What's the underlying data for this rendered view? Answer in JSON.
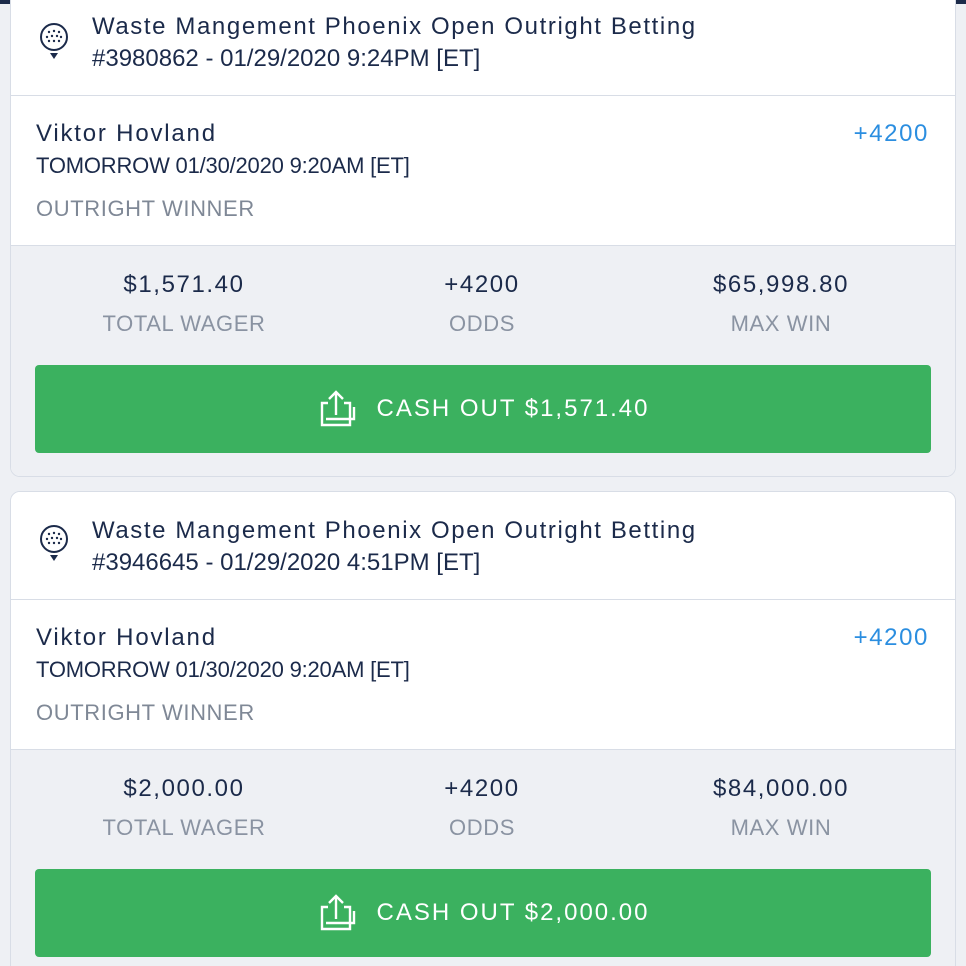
{
  "bets": [
    {
      "event_title": "Waste Mangement Phoenix Open Outright Betting",
      "ticket": "#3980862 - 01/29/2020 9:24PM [ET]",
      "player": "Viktor Hovland",
      "selection_odds": "+4200",
      "event_time": "TOMORROW 01/30/2020 9:20AM [ET]",
      "market": "OUTRIGHT WINNER",
      "total_wager": "$1,571.40",
      "total_wager_label": "TOTAL WAGER",
      "odds": "+4200",
      "odds_label": "ODDS",
      "max_win": "$65,998.80",
      "max_win_label": "MAX WIN",
      "cashout_label": "CASH OUT $1,571.40",
      "icon": "golf-ball-icon"
    },
    {
      "event_title": "Waste Mangement Phoenix Open Outright Betting",
      "ticket": "#3946645 - 01/29/2020 4:51PM [ET]",
      "player": "Viktor Hovland",
      "selection_odds": "+4200",
      "event_time": "TOMORROW 01/30/2020 9:20AM [ET]",
      "market": "OUTRIGHT WINNER",
      "total_wager": "$2,000.00",
      "total_wager_label": "TOTAL WAGER",
      "odds": "+4200",
      "odds_label": "ODDS",
      "max_win": "$84,000.00",
      "max_win_label": "MAX WIN",
      "cashout_label": "CASH OUT $2,000.00",
      "icon": "golf-ball-icon"
    }
  ],
  "colors": {
    "accent_blue": "#2b8ee0",
    "cashout_green": "#3bb15f",
    "navy_text": "#1b2a4a",
    "muted_text": "#8a93a2",
    "background": "#eef0f4"
  }
}
